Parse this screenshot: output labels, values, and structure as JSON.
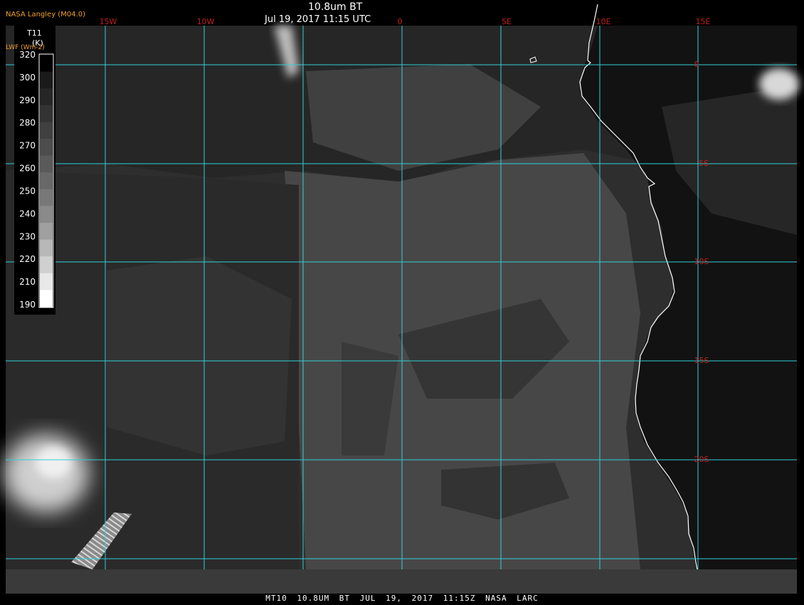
{
  "title": "10.8um BT",
  "timestamp": "Jul 19, 2017 11:15 UTC",
  "credit": "NASA Langley (M04.0)",
  "lwf_label": "LWF (Wm-2)",
  "colorbar": {
    "name": "T11",
    "unit": "(K)",
    "ticks": [
      "320",
      "300",
      "290",
      "280",
      "270",
      "260",
      "250",
      "240",
      "230",
      "220",
      "210",
      "190"
    ],
    "color_steps": [
      "#000000",
      "#1a1a1a",
      "#262626",
      "#333333",
      "#404040",
      "#4d4d4d",
      "#5a5a5a",
      "#686868",
      "#787878",
      "#8a8a8a",
      "#a0a0a0",
      "#b8b8b8",
      "#d0d0d0",
      "#e8e8e8",
      "#ffffff"
    ]
  },
  "longitude_labels": [
    "15W",
    "10W",
    "0",
    "5E",
    "10E",
    "15E"
  ],
  "latitude_labels": [
    "0",
    "5S",
    "10S",
    "15S",
    "20S"
  ],
  "footer": "MT10  10.8UM BT  JUL 19, 2017 11:15Z  NASA LARC",
  "colors": {
    "grid": "#2fd0d8",
    "grid_label": "#c02020",
    "coast": "#ffffff",
    "credit": "#f0a030"
  }
}
